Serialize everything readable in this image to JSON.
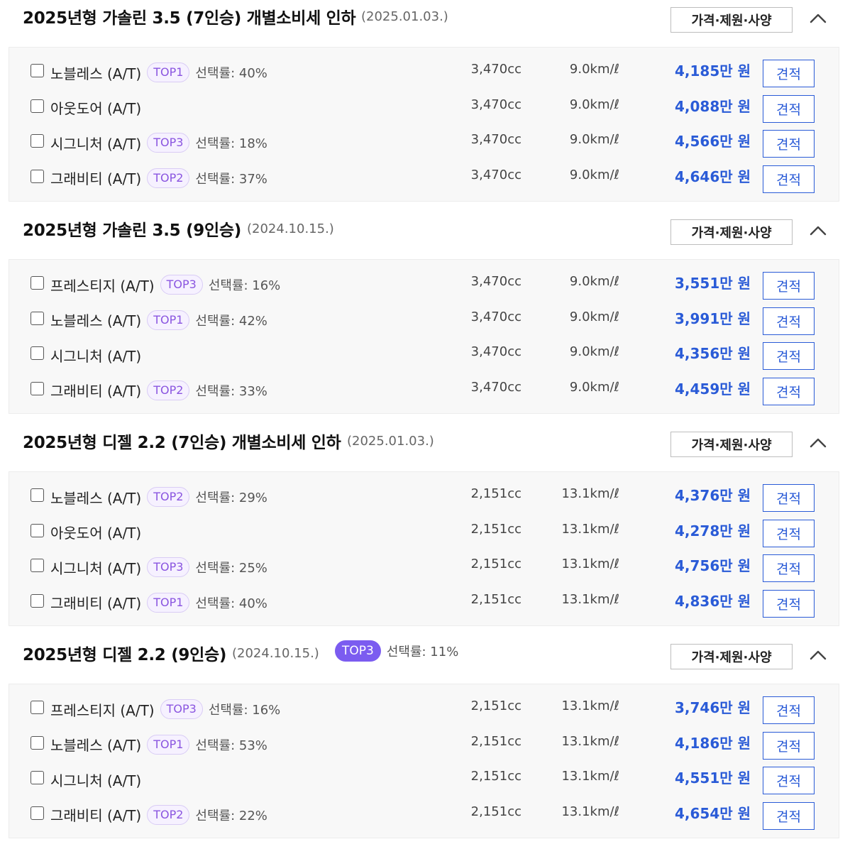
{
  "spec_button_label": "가격·제원·사양",
  "quote_button_label": "견적",
  "icons": {
    "toggle": "chevron-up-icon",
    "checkbox": "checkbox-icon"
  },
  "colors": {
    "price": "#2a5bd7",
    "badge_text": "#8a55e0",
    "badge_solid": "#7b5cf0"
  },
  "groups": [
    {
      "title": "2025년형 가솔린 3.5 (7인승) 개별소비세 인하",
      "date": "(2025.01.03.)",
      "trims": [
        {
          "name": "노블레스 (A/T)",
          "badge": "TOP1",
          "rate": "선택률: 40%",
          "cc": "3,470cc",
          "efficiency": "9.0km/ℓ",
          "price": "4,185만 원"
        },
        {
          "name": "아웃도어 (A/T)",
          "cc": "3,470cc",
          "efficiency": "9.0km/ℓ",
          "price": "4,088만 원"
        },
        {
          "name": "시그니처 (A/T)",
          "badge": "TOP3",
          "rate": "선택률: 18%",
          "cc": "3,470cc",
          "efficiency": "9.0km/ℓ",
          "price": "4,566만 원"
        },
        {
          "name": "그래비티 (A/T)",
          "badge": "TOP2",
          "rate": "선택률: 37%",
          "cc": "3,470cc",
          "efficiency": "9.0km/ℓ",
          "price": "4,646만 원"
        }
      ]
    },
    {
      "title": "2025년형 가솔린 3.5 (9인승)",
      "date": "(2024.10.15.)",
      "trims": [
        {
          "name": "프레스티지 (A/T)",
          "badge": "TOP3",
          "rate": "선택률: 16%",
          "cc": "3,470cc",
          "efficiency": "9.0km/ℓ",
          "price": "3,551만 원"
        },
        {
          "name": "노블레스 (A/T)",
          "badge": "TOP1",
          "rate": "선택률: 42%",
          "cc": "3,470cc",
          "efficiency": "9.0km/ℓ",
          "price": "3,991만 원"
        },
        {
          "name": "시그니처 (A/T)",
          "cc": "3,470cc",
          "efficiency": "9.0km/ℓ",
          "price": "4,356만 원"
        },
        {
          "name": "그래비티 (A/T)",
          "badge": "TOP2",
          "rate": "선택률: 33%",
          "cc": "3,470cc",
          "efficiency": "9.0km/ℓ",
          "price": "4,459만 원"
        }
      ]
    },
    {
      "title": "2025년형 디젤 2.2 (7인승) 개별소비세 인하",
      "date": "(2025.01.03.)",
      "trims": [
        {
          "name": "노블레스 (A/T)",
          "badge": "TOP2",
          "rate": "선택률: 29%",
          "cc": "2,151cc",
          "efficiency": "13.1km/ℓ",
          "price": "4,376만 원"
        },
        {
          "name": "아웃도어 (A/T)",
          "cc": "2,151cc",
          "efficiency": "13.1km/ℓ",
          "price": "4,278만 원"
        },
        {
          "name": "시그니처 (A/T)",
          "badge": "TOP3",
          "rate": "선택률: 25%",
          "cc": "2,151cc",
          "efficiency": "13.1km/ℓ",
          "price": "4,756만 원"
        },
        {
          "name": "그래비티 (A/T)",
          "badge": "TOP1",
          "rate": "선택률: 40%",
          "cc": "2,151cc",
          "efficiency": "13.1km/ℓ",
          "price": "4,836만 원"
        }
      ]
    },
    {
      "title": "2025년형 디젤 2.2 (9인승)",
      "date": "(2024.10.15.)",
      "badge": "TOP3",
      "rate": "선택률: 11%",
      "trims": [
        {
          "name": "프레스티지 (A/T)",
          "badge": "TOP3",
          "rate": "선택률: 16%",
          "cc": "2,151cc",
          "efficiency": "13.1km/ℓ",
          "price": "3,746만 원"
        },
        {
          "name": "노블레스 (A/T)",
          "badge": "TOP1",
          "rate": "선택률: 53%",
          "cc": "2,151cc",
          "efficiency": "13.1km/ℓ",
          "price": "4,186만 원"
        },
        {
          "name": "시그니처 (A/T)",
          "cc": "2,151cc",
          "efficiency": "13.1km/ℓ",
          "price": "4,551만 원"
        },
        {
          "name": "그래비티 (A/T)",
          "badge": "TOP2",
          "rate": "선택률: 22%",
          "cc": "2,151cc",
          "efficiency": "13.1km/ℓ",
          "price": "4,654만 원"
        }
      ]
    }
  ]
}
